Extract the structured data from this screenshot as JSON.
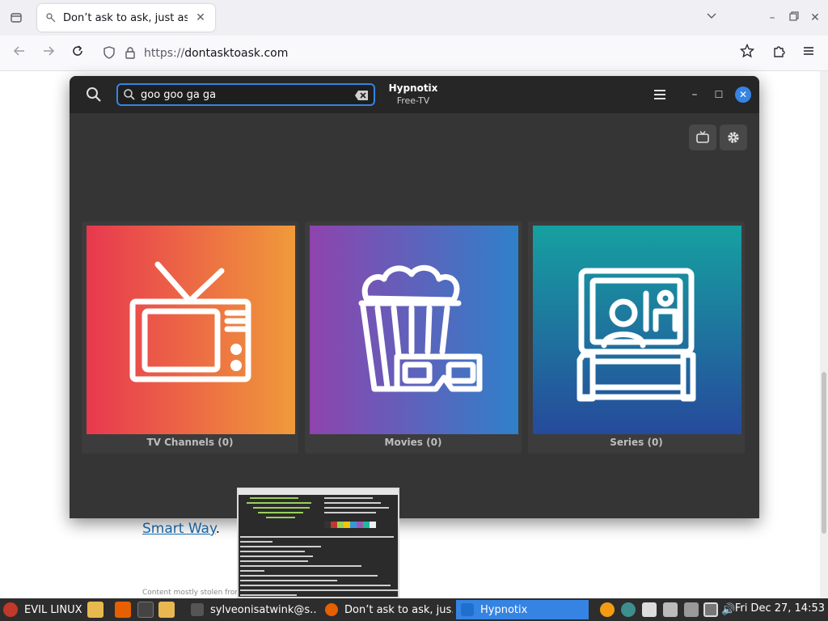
{
  "browser": {
    "tab_title": "Don’t ask to ask, just ask",
    "url_protocol": "https://",
    "url_host": "dontasktoask.com"
  },
  "page": {
    "link_text": "Smart Way",
    "link_suffix": ".",
    "footer_text": "Content mostly stolen from"
  },
  "app": {
    "title": "Hypnotix",
    "subtitle": "Free-TV",
    "search_value": "goo goo ga ga",
    "cards": [
      {
        "label": "TV Channels (0)",
        "icon": "tv-icon",
        "colors": [
          "#e8384f",
          "#f09a3a"
        ]
      },
      {
        "label": "Movies (0)",
        "icon": "popcorn-3d-glasses-icon",
        "colors": [
          "#8e44ad",
          "#2f80c9"
        ]
      },
      {
        "label": "Series (0)",
        "icon": "person-watching-tv-icon",
        "colors": [
          "#16a0a0",
          "#264a9c"
        ]
      }
    ]
  },
  "taskbar": {
    "menu_label": "EVIL LINUX",
    "tasks": [
      {
        "label": "sylveonisatwink@s...",
        "icon": "terminal-icon",
        "color": "#555555"
      },
      {
        "label": "Don’t ask to ask, jus...",
        "icon": "firefox-icon",
        "color": "#e66000"
      },
      {
        "label": "Hypnotix",
        "icon": "tv-icon",
        "color": "#3584e4"
      }
    ],
    "clock": "Fri Dec 27, 14:53"
  }
}
